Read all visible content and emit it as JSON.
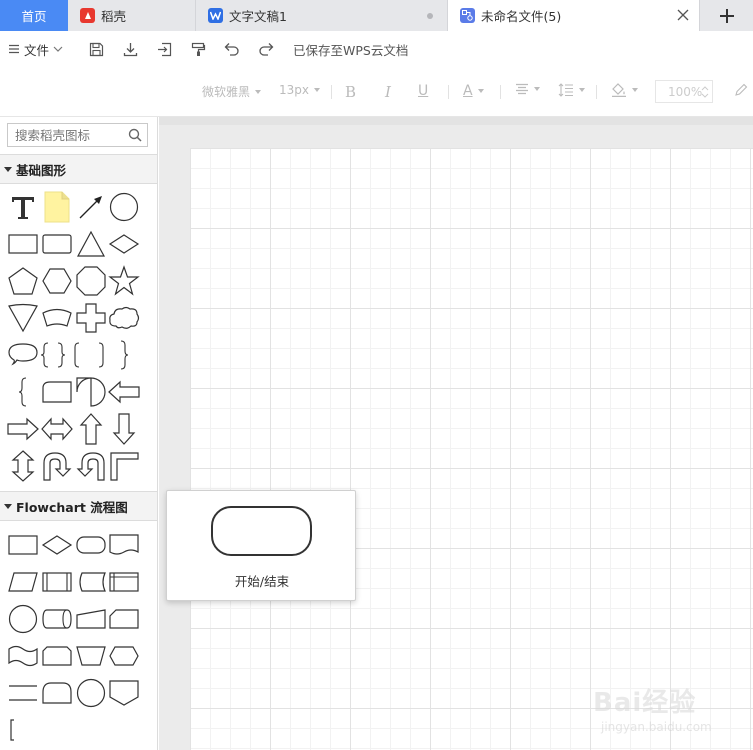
{
  "tabs": [
    {
      "label": "首页",
      "type": "home"
    },
    {
      "label": "稻壳",
      "type": "docer",
      "icon": "docer-icon",
      "color": "#e8382f"
    },
    {
      "label": "文字文稿1",
      "type": "writer",
      "icon": "wps-writer-icon",
      "color": "#2f6fe4"
    },
    {
      "label": "未命名文件(5)",
      "type": "flowchart",
      "icon": "flowchart-icon",
      "color": "#5a7be8",
      "active": true
    }
  ],
  "toolbar": {
    "file_label": "文件",
    "saved_status": "已保存至WPS云文档"
  },
  "format_bar": {
    "font_family": "微软雅黑",
    "font_size": "13px",
    "bold": "B",
    "italic": "I",
    "underline": "U",
    "font_color": "A",
    "zoom": "100%"
  },
  "sidebar": {
    "search_placeholder": "搜索稻壳图标",
    "sections": [
      {
        "title": "基础图形"
      },
      {
        "title": "Flowchart 流程图"
      }
    ]
  },
  "preview": {
    "caption": "开始/结束"
  },
  "watermark": {
    "main": "Bai经验",
    "sub": "jingyan.baidu.com"
  },
  "colors": {
    "home_tab": "#4a8af4",
    "canvas_bg": "#ebebeb",
    "grid_major": "#e2e2e2"
  }
}
